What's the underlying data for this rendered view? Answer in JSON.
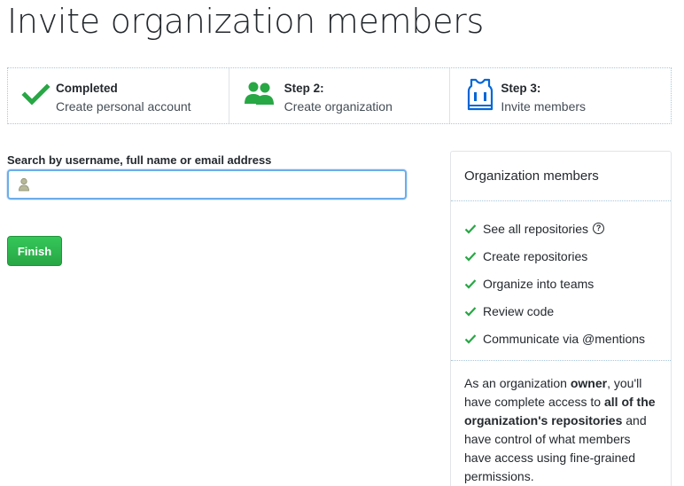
{
  "page": {
    "title": "Invite organization members"
  },
  "steps": [
    {
      "icon": "check-icon",
      "heading": "Completed",
      "subtitle": "Create personal account"
    },
    {
      "icon": "people-icon",
      "heading": "Step 2:",
      "subtitle": "Create organization"
    },
    {
      "icon": "jersey-icon",
      "heading": "Step 3:",
      "subtitle": "Invite members"
    }
  ],
  "search": {
    "label": "Search by username, full name or email address",
    "value": "",
    "placeholder": ""
  },
  "finish": {
    "label": "Finish"
  },
  "members_panel": {
    "title": "Organization members",
    "permissions": [
      "See all repositories",
      "Create repositories",
      "Organize into teams",
      "Review code",
      "Communicate via @mentions"
    ],
    "help_glyph": "?",
    "owner_text": {
      "part1": "As an organization ",
      "owner_word": "owner",
      "part2": ", you'll have complete access to ",
      "bold_access": "all of the organization's repositories",
      "part3": " and have control of what members have access using fine-grained permissions."
    }
  },
  "colors": {
    "check_green": "#28a745",
    "step_blue": "#0366d6",
    "finish_green": "#28a745",
    "focus_blue": "#6caeea"
  }
}
